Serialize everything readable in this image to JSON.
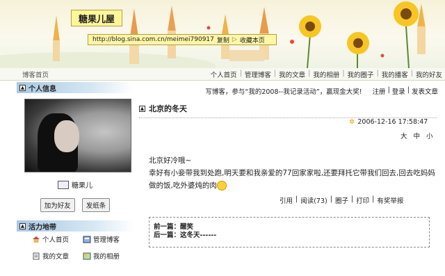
{
  "blog": {
    "title": "糖果儿屋",
    "url": "http://blog.sina.com.cn/meimei790917",
    "copy_label": "复制",
    "bookmark_label": "收藏本页"
  },
  "nav": {
    "home": "博客首页",
    "links": [
      "个人首页",
      "管理博客",
      "我的文章",
      "我的相册",
      "我的圈子",
      "我的播客",
      "我的好友"
    ]
  },
  "sidebar": {
    "profile_heading": "个人信息",
    "username": "糖果儿",
    "add_friend": "加为好友",
    "send_note": "发纸条",
    "tools_heading": "活力地带",
    "tools": [
      "个人首页",
      "管理博客",
      "我的文章",
      "我的相册"
    ]
  },
  "header": {
    "promo": "写博客，参与“我的2008--我记录活动”，赢现金大奖!",
    "register": "注册",
    "login": "登录",
    "post_article": "发表文章"
  },
  "post": {
    "title": "北京的冬天",
    "datetime": "2006-12-16 17:58:47",
    "size_large": "大",
    "size_medium": "中",
    "size_small": "小",
    "line1": "北京好冷哦~",
    "line2": "幸好有小妾带我到处跑,明天要和我亲爱的77回家家啦,还要拜托它带我们回去,回去吃妈妈做的饭,吃外婆炖的肉",
    "quote": "引用",
    "read": "阅读(73)",
    "circle": "圈子",
    "print": "打印",
    "report": "有奖举报",
    "prev": "前一篇：醒笑",
    "next": "后一篇：这冬天------"
  }
}
